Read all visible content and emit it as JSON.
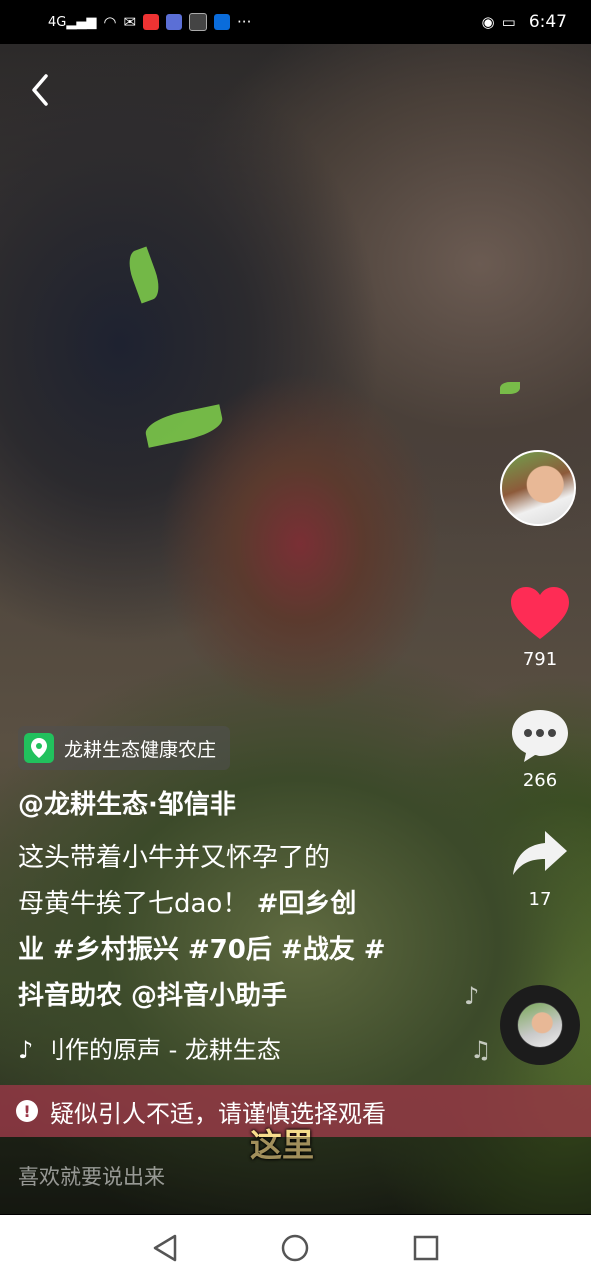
{
  "status_bar": {
    "network": "4G",
    "time": "6:47"
  },
  "location": {
    "label": "龙耕生态健康农庄"
  },
  "author": "@龙耕生态·邹信非",
  "description": {
    "line1": "这头带着小牛并又怀孕了的",
    "line2_text": "母黄牛挨了七dao！",
    "line2_tag": "#回乡创",
    "line3": "业 #乡村振兴 #70后 #战友 #",
    "line4": "抖音助农 @抖音小助手"
  },
  "music": "♪ 刂作的原声 - 龙耕生态",
  "counts": {
    "likes": "791",
    "comments": "266",
    "shares": "17"
  },
  "warning": "疑似引人不适，请谨慎选择观看",
  "subtitle": "这里",
  "comment_input_placeholder": "喜欢就要说出来",
  "colors": {
    "like": "#fe2c55",
    "warning_bg": "#963746",
    "location_icon": "#21c15d"
  }
}
